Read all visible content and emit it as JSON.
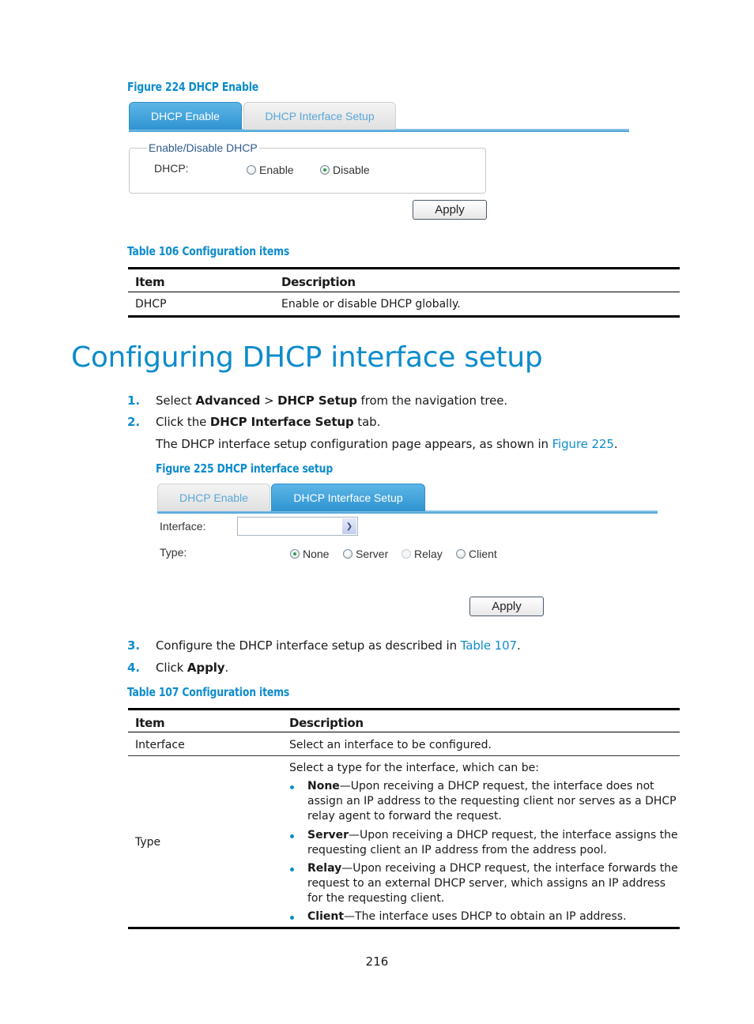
{
  "figure224": {
    "caption": "Figure 224 DHCP Enable",
    "tabs": [
      {
        "label": "DHCP Enable",
        "active": true
      },
      {
        "label": "DHCP Interface Setup",
        "active": false
      }
    ],
    "fieldset_legend": "Enable/Disable DHCP",
    "dhcp_label": "DHCP:",
    "radios": [
      {
        "label": "Enable",
        "checked": false
      },
      {
        "label": "Disable",
        "checked": true
      }
    ],
    "apply_label": "Apply"
  },
  "table106": {
    "caption": "Table 106 Configuration items",
    "headers": [
      "Item",
      "Description"
    ],
    "rows": [
      {
        "item": "DHCP",
        "description": "Enable or disable DHCP globally."
      }
    ]
  },
  "section": {
    "heading": "Configuring DHCP interface setup",
    "steps": [
      {
        "num": "1.",
        "pre": "Select ",
        "b1": "Advanced",
        "mid": " > ",
        "b2": "DHCP Setup",
        "post": " from the navigation tree."
      },
      {
        "num": "2.",
        "pre": "Click the ",
        "b1": "DHCP Interface Setup",
        "post": " tab."
      }
    ],
    "step2_note_pre": "The DHCP interface setup configuration page appears, as shown in ",
    "step2_note_link": "Figure 225",
    "step2_note_post": ".",
    "steps_after": [
      {
        "num": "3.",
        "pre": "Configure the DHCP interface setup as described in ",
        "link": "Table 107",
        "post": "."
      },
      {
        "num": "4.",
        "pre": "Click ",
        "b1": "Apply",
        "post": "."
      }
    ]
  },
  "figure225": {
    "caption": "Figure 225 DHCP interface setup",
    "tabs": [
      {
        "label": "DHCP Enable",
        "active": false
      },
      {
        "label": "DHCP Interface Setup",
        "active": true
      }
    ],
    "interface_label": "Interface:",
    "interface_value": "",
    "type_label": "Type:",
    "radios": [
      {
        "label": "None",
        "checked": true,
        "disabled": false
      },
      {
        "label": "Server",
        "checked": false,
        "disabled": false
      },
      {
        "label": "Relay",
        "checked": false,
        "disabled": true
      },
      {
        "label": "Client",
        "checked": false,
        "disabled": false
      }
    ],
    "apply_label": "Apply"
  },
  "table107": {
    "caption": "Table 107 Configuration items",
    "headers": [
      "Item",
      "Description"
    ],
    "rows": [
      {
        "item": "Interface",
        "description": "Select an interface to be configured."
      },
      {
        "item": "Type",
        "intro": "Select a type for the interface, which can be:",
        "bullets": [
          {
            "term": "None",
            "text": "—Upon receiving a DHCP request, the interface does not assign an IP address to the requesting client nor serves as a DHCP relay agent to forward the request."
          },
          {
            "term": "Server",
            "text": "—Upon receiving a DHCP request, the interface assigns the requesting client an IP address from the address pool."
          },
          {
            "term": "Relay",
            "text": "—Upon receiving a DHCP request, the interface forwards the request to an external DHCP server, which assigns an IP address for the requesting client."
          },
          {
            "term": "Client",
            "text": "—The interface uses DHCP to obtain an IP address."
          }
        ]
      }
    ]
  },
  "page_number": "216",
  "colors": {
    "accent": "#0d8ccc",
    "tab_active": "#3399d4",
    "radio_checked": "#2aa24a"
  }
}
